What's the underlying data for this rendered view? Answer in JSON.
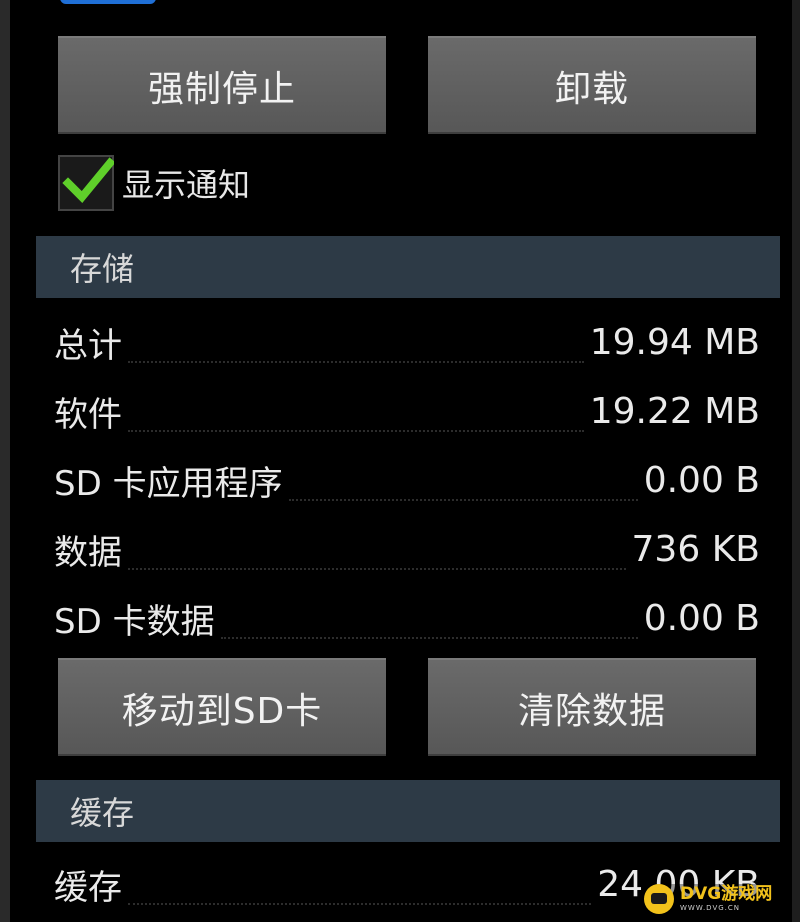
{
  "buttons": {
    "force_stop": "强制停止",
    "uninstall": "卸载",
    "move_to_sd": "移动到SD卡",
    "clear_data": "清除数据"
  },
  "notification": {
    "label": "显示通知",
    "checked": true
  },
  "storage": {
    "header": "存储",
    "rows": [
      {
        "label": "总计",
        "value": "19.94 MB"
      },
      {
        "label": "软件",
        "value": "19.22 MB"
      },
      {
        "label": "SD 卡应用程序",
        "value": "0.00 B"
      },
      {
        "label": "数据",
        "value": "736 KB"
      },
      {
        "label": "SD 卡数据",
        "value": "0.00 B"
      }
    ]
  },
  "cache": {
    "header": "缓存",
    "rows": [
      {
        "label": "缓存",
        "value": "24.00 KB"
      }
    ]
  },
  "watermark": {
    "main": "DVG游戏网",
    "sub": "WWW.DVG.CN"
  },
  "colors": {
    "background": "#000000",
    "button": "#5f5f5f",
    "section_header": "#2d3a46",
    "checkmark": "#5fcf2a",
    "watermark": "#f2c21b"
  }
}
